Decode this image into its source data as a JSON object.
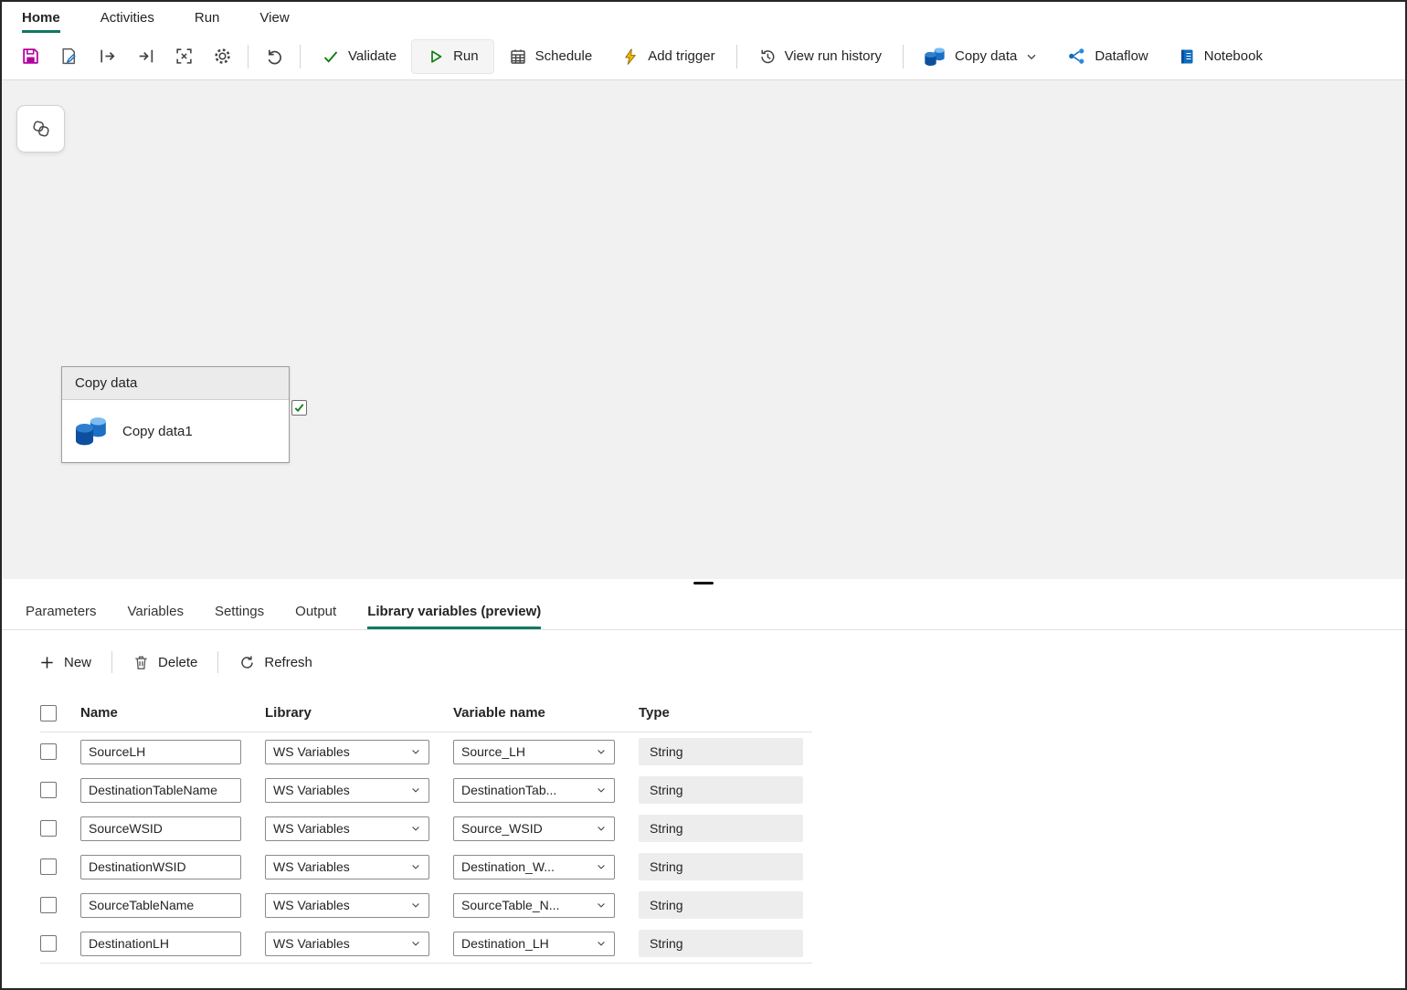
{
  "colors": {
    "accent_teal": "#117865",
    "save_purple": "#b4009e",
    "run_green": "#107c10",
    "trigger_yellow": "#ffb900",
    "fabric_blue": "#0f6cbd"
  },
  "menubar": {
    "tabs": [
      {
        "label": "Home",
        "active": true
      },
      {
        "label": "Activities",
        "active": false
      },
      {
        "label": "Run",
        "active": false
      },
      {
        "label": "View",
        "active": false
      }
    ]
  },
  "toolbar": {
    "validate_label": "Validate",
    "run_label": "Run",
    "schedule_label": "Schedule",
    "add_trigger_label": "Add trigger",
    "view_run_history_label": "View run history",
    "copy_data_label": "Copy data",
    "dataflow_label": "Dataflow",
    "notebook_label": "Notebook"
  },
  "canvas": {
    "activity": {
      "header": "Copy data",
      "name": "Copy data1"
    }
  },
  "panel": {
    "tabs": [
      {
        "label": "Parameters",
        "active": false
      },
      {
        "label": "Variables",
        "active": false
      },
      {
        "label": "Settings",
        "active": false
      },
      {
        "label": "Output",
        "active": false
      },
      {
        "label": "Library variables (preview)",
        "active": true
      }
    ],
    "actions": {
      "new_label": "New",
      "delete_label": "Delete",
      "refresh_label": "Refresh"
    },
    "table": {
      "headers": {
        "name": "Name",
        "library": "Library",
        "variable_name": "Variable name",
        "type": "Type"
      },
      "rows": [
        {
          "name": "SourceLH",
          "library": "WS Variables",
          "variable_name": "Source_LH",
          "type": "String"
        },
        {
          "name": "DestinationTableName",
          "library": "WS Variables",
          "variable_name": "DestinationTab...",
          "type": "String"
        },
        {
          "name": "SourceWSID",
          "library": "WS Variables",
          "variable_name": "Source_WSID",
          "type": "String"
        },
        {
          "name": "DestinationWSID",
          "library": "WS Variables",
          "variable_name": "Destination_W...",
          "type": "String"
        },
        {
          "name": "SourceTableName",
          "library": "WS Variables",
          "variable_name": "SourceTable_N...",
          "type": "String"
        },
        {
          "name": "DestinationLH",
          "library": "WS Variables",
          "variable_name": "Destination_LH",
          "type": "String"
        }
      ]
    }
  }
}
